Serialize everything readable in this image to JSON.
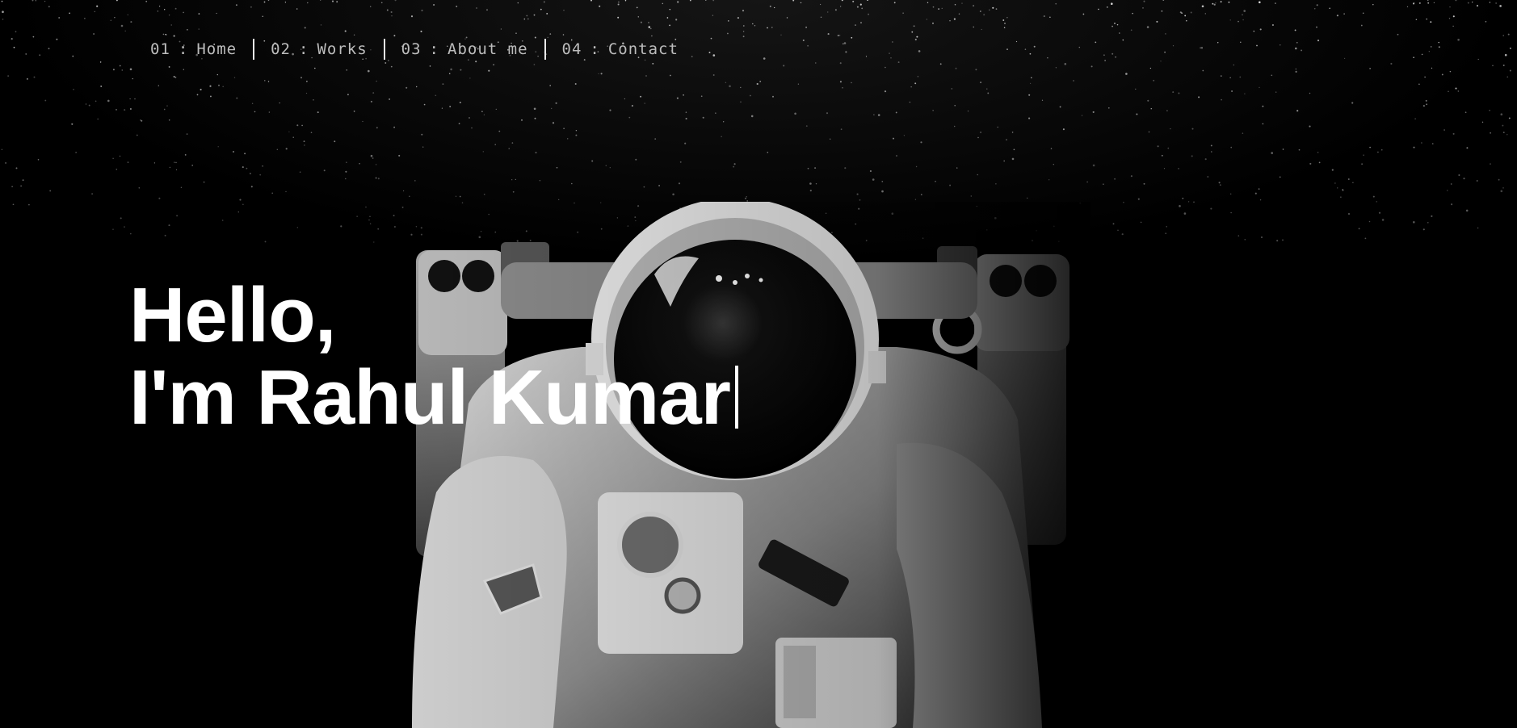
{
  "nav": {
    "items": [
      {
        "number": "01",
        "separator": ":",
        "label": "Home"
      },
      {
        "number": "02",
        "separator": ":",
        "label": "Works"
      },
      {
        "number": "03",
        "separator": ":",
        "label": "About me"
      },
      {
        "number": "04",
        "separator": ":",
        "label": "Contact"
      }
    ]
  },
  "hero": {
    "line1": "Hello,",
    "line2": "I'm Rahul Kumar"
  },
  "colors": {
    "background": "#000000",
    "heading": "#ffffff",
    "nav_text": "#bdbdbd"
  },
  "icons": {
    "background_image": "astronaut-illustration",
    "text_cursor": "typing-cursor"
  }
}
